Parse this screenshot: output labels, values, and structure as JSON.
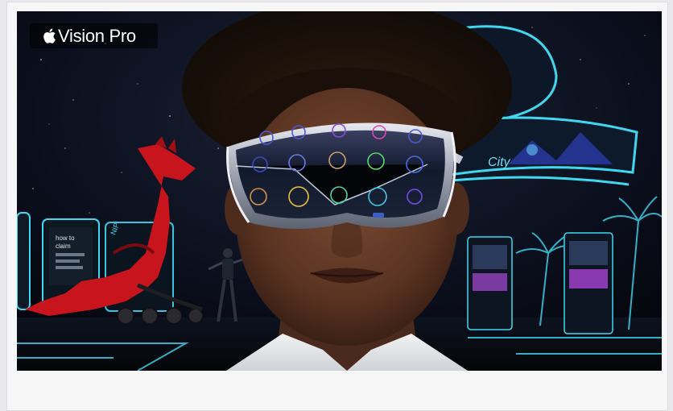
{
  "hero": {
    "brand_text": "Vision Pro",
    "brand_icon": "apple-logo-icon",
    "alt_description": ""
  },
  "colors": {
    "page_background": "#e9e9eb",
    "card_background": "#f6f6f7",
    "scene_background": "#05060d",
    "neon_cyan": "#3fd8f0",
    "robot_red": "#c8141c"
  }
}
